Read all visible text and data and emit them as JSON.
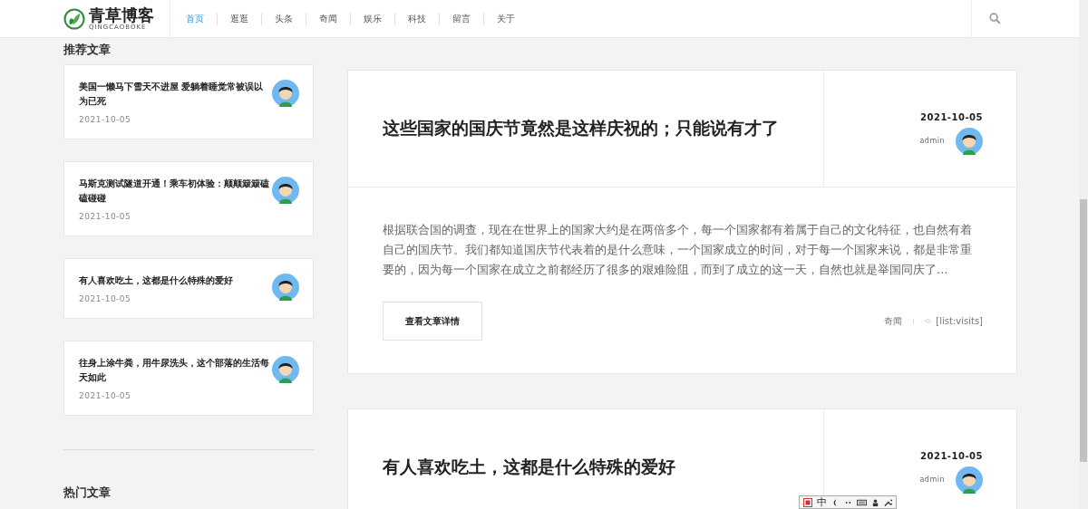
{
  "header": {
    "logo": {
      "title": "青草博客",
      "subtitle": "QINGCAOBOKE"
    },
    "nav": [
      {
        "label": "首页",
        "selected": true
      },
      {
        "label": "逛逛",
        "selected": false
      },
      {
        "label": "头条",
        "selected": false
      },
      {
        "label": "奇闻",
        "selected": false
      },
      {
        "label": "娱乐",
        "selected": false
      },
      {
        "label": "科技",
        "selected": false
      },
      {
        "label": "留言",
        "selected": false
      },
      {
        "label": "关于",
        "selected": false
      }
    ]
  },
  "sidebar": {
    "section_title": "推荐文章",
    "articles": [
      {
        "title": "美国一懒马下雪天不进屋 爱躺着睡觉常被误以为已死",
        "date": "2021-10-05"
      },
      {
        "title": "马斯克测试隧道开通！乘车初体验：颠颠簸簸磕磕碰碰",
        "date": "2021-10-05"
      },
      {
        "title": "有人喜欢吃土，这都是什么特殊的爱好",
        "date": "2021-10-05"
      },
      {
        "title": "往身上涂牛粪，用牛尿洗头，这个部落的生活每天如此",
        "date": "2021-10-05"
      }
    ],
    "section_title_2": "热门文章"
  },
  "posts": [
    {
      "title": "这些国家的国庆节竟然是这样庆祝的；只能说有才了",
      "date": "2021-10-05",
      "author": "admin",
      "excerpt": "根据联合国的调查，现在在世界上的国家大约是在两倍多个，每一个国家都有着属于自己的文化特征，也自然有着自己的国庆节。我们都知道国庆节代表着的是什么意味，一个国家成立的时间，对于每一个国家来说，都是非常重要的，因为每一个国家在成立之前都经历了很多的艰难险阻，而到了成立的这一天，自然也就是举国同庆了...",
      "button": "查看文章详情",
      "category": "奇闻",
      "visits": "[list:visits]"
    },
    {
      "title": "有人喜欢吃土，这都是什么特殊的爱好",
      "date": "2021-10-05",
      "author": "admin"
    }
  ],
  "ime_toolbar": {
    "mode": "中"
  }
}
